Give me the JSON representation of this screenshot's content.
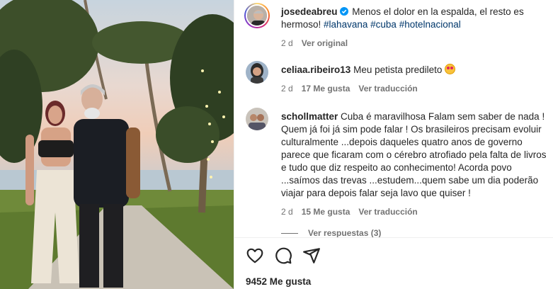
{
  "post": {
    "author": "josedeabreu",
    "caption_text": "Menos el dolor en la espalda, el resto es hermoso!",
    "hashtags": [
      "#lahavana",
      "#cuba",
      "#hotelnacional"
    ],
    "time": "2 d",
    "see_translation": "Ver original"
  },
  "comments": [
    {
      "user": "celiaa.ribeiro13",
      "text": "Meu petista predileto",
      "time": "2 d",
      "likes": "17 Me gusta",
      "translate": "Ver traducción"
    },
    {
      "user": "schollmatter",
      "text": "Cuba é maravilhosa Falam sem saber de nada ! Quem já foi já sim pode falar ! Os brasileiros precisam evoluir culturalmente ...depois daqueles quatro anos de governo parece que ficaram com o cérebro atrofiado pela falta de livros e tudo que diz respeito ao conhecimento! Acorda povo ...saímos das trevas ...estudem...quem sabe um dia poderão viajar para depois falar seja lavo que quiser !",
      "time": "2 d",
      "likes": "15 Me gusta",
      "translate": "Ver traducción"
    }
  ],
  "replies_label": "Ver respuestas (3)",
  "likes_count": "9452 Me gusta",
  "icons": [
    "heart-icon",
    "comment-icon",
    "share-icon",
    "verified-badge-icon",
    "heart-eyes-emoji"
  ],
  "colors": {
    "link": "#00376b",
    "muted": "#737373",
    "verified": "#0095f6"
  }
}
